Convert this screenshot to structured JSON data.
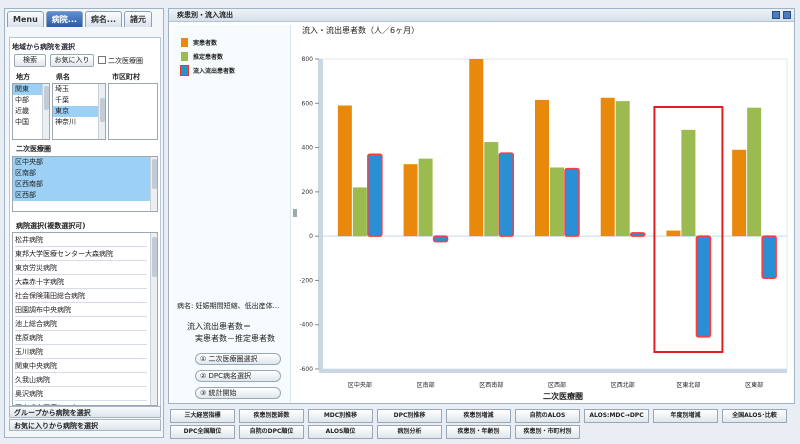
{
  "left": {
    "tabs": [
      "Menu",
      "病院...",
      "病名...",
      "諸元"
    ],
    "region_title": "地域から病院を選択",
    "search_label": "検索",
    "favorites_label": "お気に入り",
    "secondary_check_label": "二次医療圏",
    "col_region": "地方",
    "col_pref": "県名",
    "col_city": "市区町村",
    "regions": [
      {
        "label": "関東",
        "selected": true
      },
      {
        "label": "中部",
        "selected": false
      },
      {
        "label": "近畿",
        "selected": false
      },
      {
        "label": "中国",
        "selected": false
      }
    ],
    "prefectures": [
      {
        "label": "埼玉",
        "selected": false
      },
      {
        "label": "千葉",
        "selected": false
      },
      {
        "label": "東京",
        "selected": true
      },
      {
        "label": "神奈川",
        "selected": false
      }
    ],
    "secondary_area_title": "二次医療圏",
    "secondary_areas": [
      {
        "label": "区中央部",
        "selected": true
      },
      {
        "label": "区南部",
        "selected": true
      },
      {
        "label": "区西南部",
        "selected": true
      },
      {
        "label": "区西部",
        "selected": true
      }
    ],
    "hospital_title": "病院選択(複数選択可)",
    "hospitals": [
      "松井病院",
      "東邦大学医療センター大森病院",
      "東京労災病院",
      "大森赤十字病院",
      "社会保険蒲田総合病院",
      "田園調布中央病院",
      "池上総合病院",
      "荏原病院",
      "玉川病院",
      "関東中央病院",
      "久我山病院",
      "奥沢病院",
      "国立成育医療センター"
    ],
    "group_link": "グループから病院を選択",
    "fav_link": "お気に入りから病院を選択"
  },
  "main": {
    "title": "疾患別・流入流出",
    "disease_name": "病名: 妊娠期間短縮、低出産体...",
    "formula1": "流入流出患者数＝",
    "formula2": "実患者数－推定患者数",
    "btn_area": "① 二次医療圏選択",
    "btn_dpc": "② DPC病名選択",
    "btn_stats": "③ 統計開始"
  },
  "chart_data": {
    "type": "bar",
    "title": "流入・流出患者数（人／6ヶ月）",
    "xlabel": "二次医療圏",
    "ylabel": "",
    "ylim": [
      -600,
      800
    ],
    "yticks": [
      -600,
      -400,
      -200,
      0,
      200,
      400,
      600,
      800
    ],
    "categories": [
      "区中央部",
      "区南部",
      "区西南部",
      "区西部",
      "区西北部",
      "区東北部",
      "区東部"
    ],
    "series": [
      {
        "name": "実患者数",
        "color": "#e8890c",
        "values": [
          590,
          325,
          800,
          615,
          625,
          25,
          390
        ]
      },
      {
        "name": "推定患者数",
        "color": "#9bbb50",
        "values": [
          220,
          350,
          425,
          310,
          610,
          480,
          580
        ]
      },
      {
        "name": "流入流出患者数",
        "color": "#2b8fd6",
        "values": [
          370,
          -25,
          375,
          305,
          15,
          -455,
          -190
        ]
      }
    ],
    "highlighted_category": "区東北部",
    "highlight_color": "#e02020",
    "grid": false,
    "legend": "left"
  },
  "footer": {
    "row1": [
      "三大経営指標",
      "疾患別医師数",
      "MDC別推移",
      "DPC別推移",
      "疾患別増減",
      "自院のALOS",
      "ALOS:MDC→DPC",
      "年度別増減",
      "全国ALOS･比較"
    ],
    "row2": [
      "DPC全国順位",
      "自院のDPC順位",
      "ALOS順位",
      "病別分析",
      "疾患別・年齢別",
      "疾患別・市町村別"
    ]
  }
}
